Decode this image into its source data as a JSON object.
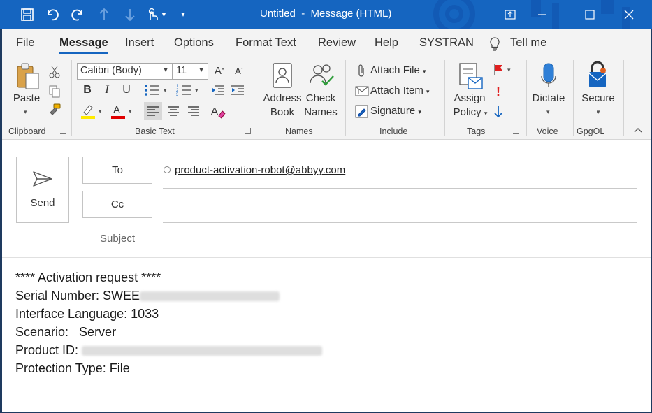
{
  "titlebar": {
    "title": "Untitled  -  Message (HTML)",
    "quick_access": [
      "save-icon",
      "undo-icon",
      "redo-icon",
      "up-arrow-icon",
      "down-arrow-icon",
      "touch-mode-icon",
      "customize-icon"
    ]
  },
  "menu": {
    "tabs": [
      "File",
      "Message",
      "Insert",
      "Options",
      "Format Text",
      "Review",
      "Help",
      "SYSTRAN"
    ],
    "active": "Message",
    "tell_me": "Tell me"
  },
  "ribbon": {
    "clipboard": {
      "paste": "Paste",
      "label": "Clipboard"
    },
    "basic_text": {
      "font": "Calibri (Body)",
      "size": "11",
      "label": "Basic Text"
    },
    "names": {
      "address_book_1": "Address",
      "address_book_2": "Book",
      "check_names_1": "Check",
      "check_names_2": "Names",
      "label": "Names"
    },
    "include": {
      "attach_file": "Attach File",
      "attach_item": "Attach Item",
      "signature": "Signature",
      "label": "Include"
    },
    "tags": {
      "assign_policy_1": "Assign",
      "assign_policy_2": "Policy",
      "label": "Tags"
    },
    "voice": {
      "dictate": "Dictate",
      "label": "Voice"
    },
    "gpgol": {
      "secure": "Secure",
      "label": "GpgOL"
    }
  },
  "compose": {
    "send": "Send",
    "to": "To",
    "cc": "Cc",
    "subject": "Subject",
    "recipient": "product-activation-robot@abbyy.com",
    "body": {
      "line1": "**** Activation request ****",
      "serial_label": "Serial Number: SWEE",
      "language": "Interface Language: 1033",
      "scenario": "Scenario:   Server",
      "product_label": "Product ID: ",
      "protection": "Protection Type: File"
    }
  },
  "colors": {
    "titlebar": "#1565c0",
    "ribbon": "#f3f3f3",
    "accent": "#1565c0"
  }
}
